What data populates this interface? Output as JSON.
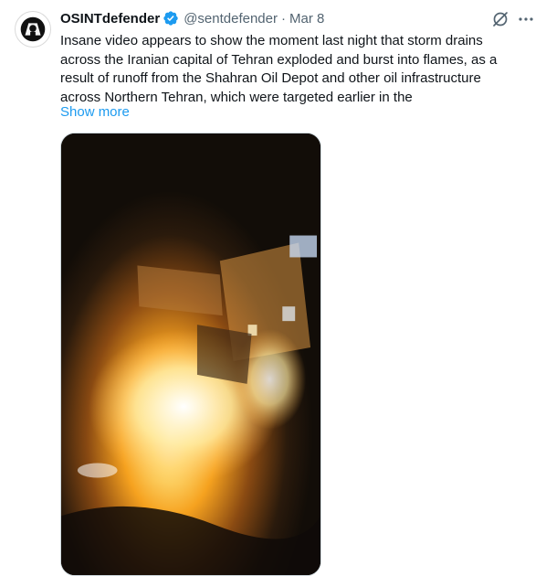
{
  "tweet": {
    "display_name": "OSINTdefender",
    "handle": "@sentdefender",
    "separator": "·",
    "time": "Mar 8",
    "text": "Insane video appears to show the moment last night that storm drains across the Iranian capital of Tehran exploded and burst into flames, as a result of runoff from the Shahran Oil Depot and other oil infrastructure across Northern Tehran, which were targeted earlier in the",
    "show_more": "Show more"
  },
  "icons": {
    "avatar": "avatar-logo-icon",
    "verified": "verified-badge-icon",
    "grok": "grok-icon",
    "more": "more-options-icon"
  },
  "colors": {
    "text": "#0f1419",
    "secondary": "#536471",
    "link": "#1d9bf0",
    "verified": "#1d9bf0"
  }
}
